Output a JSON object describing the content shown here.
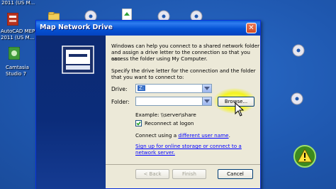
{
  "desktop": {
    "top_cut_label": "2011 (US M...",
    "autocad_label_1": "AutoCAD MEP",
    "autocad_label_2": "2011 (US M...",
    "camtasia_label_1": "Camtasia",
    "camtasia_label_2": "Studio 7"
  },
  "dialog": {
    "title": "Map Network Drive",
    "intro_line_1": "Windows can help you connect to a shared network folder",
    "intro_line_2": "and assign a drive letter to the connection so that you can",
    "intro_line_3": "access the folder using My Computer.",
    "specify_line_1": "Specify the drive letter for the connection and the folder",
    "specify_line_2": "that you want to connect to:",
    "drive_label": "Drive:",
    "drive_value": "Z:",
    "folder_label": "Folder:",
    "folder_value": "",
    "browse_label": "Browse...",
    "example_text": "Example: \\\\server\\share",
    "reconnect_label": "Reconnect at logon",
    "reconnect_checked": true,
    "connect_prefix": "Connect using a ",
    "connect_link": "different user name",
    "connect_suffix": ".",
    "signup_line_1": "Sign up for online storage or connect to a",
    "signup_line_2": "network server.",
    "back_label": "< Back",
    "finish_label": "Finish",
    "cancel_label": "Cancel"
  },
  "colors": {
    "desktop_bg": "#1f58b0",
    "titlebar": "#0553d4",
    "side_panel": "#0b2c7a",
    "dialog_bg": "#ece9d8",
    "highlight_glow": "#f4f400"
  }
}
